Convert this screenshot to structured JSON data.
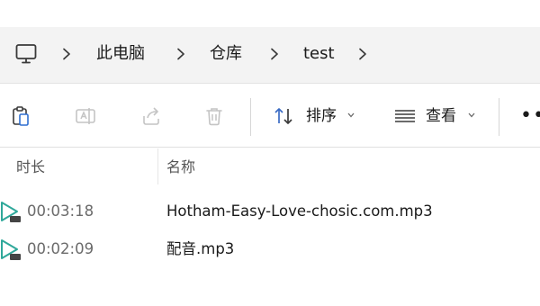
{
  "breadcrumb": {
    "root_icon": "computer-icon",
    "items": [
      {
        "label": "此电脑"
      },
      {
        "label": "仓库"
      },
      {
        "label": "test"
      }
    ]
  },
  "toolbar": {
    "paste_icon": "clipboard-icon",
    "rename_icon": "rename-icon",
    "share_icon": "share-icon",
    "delete_icon": "trash-icon",
    "sort_label": "排序",
    "view_label": "查看",
    "more_label": "•••"
  },
  "columns": [
    {
      "label": "时长"
    },
    {
      "label": "名称"
    }
  ],
  "files": [
    {
      "duration": "00:03:18",
      "name": "Hotham-Easy-Love-chosic.com.mp3",
      "icon": "mp3-file-icon"
    },
    {
      "duration": "00:02:09",
      "name": "配音.mp3",
      "icon": "mp3-file-icon"
    }
  ],
  "colors": {
    "address_bg": "#f3f3f3",
    "text": "#1a1a1a",
    "muted": "#6b6b6b",
    "disabled_icon": "#c4c4c4",
    "sort_icon": "#3a6bc4",
    "play_icon": "#2fa89a"
  }
}
